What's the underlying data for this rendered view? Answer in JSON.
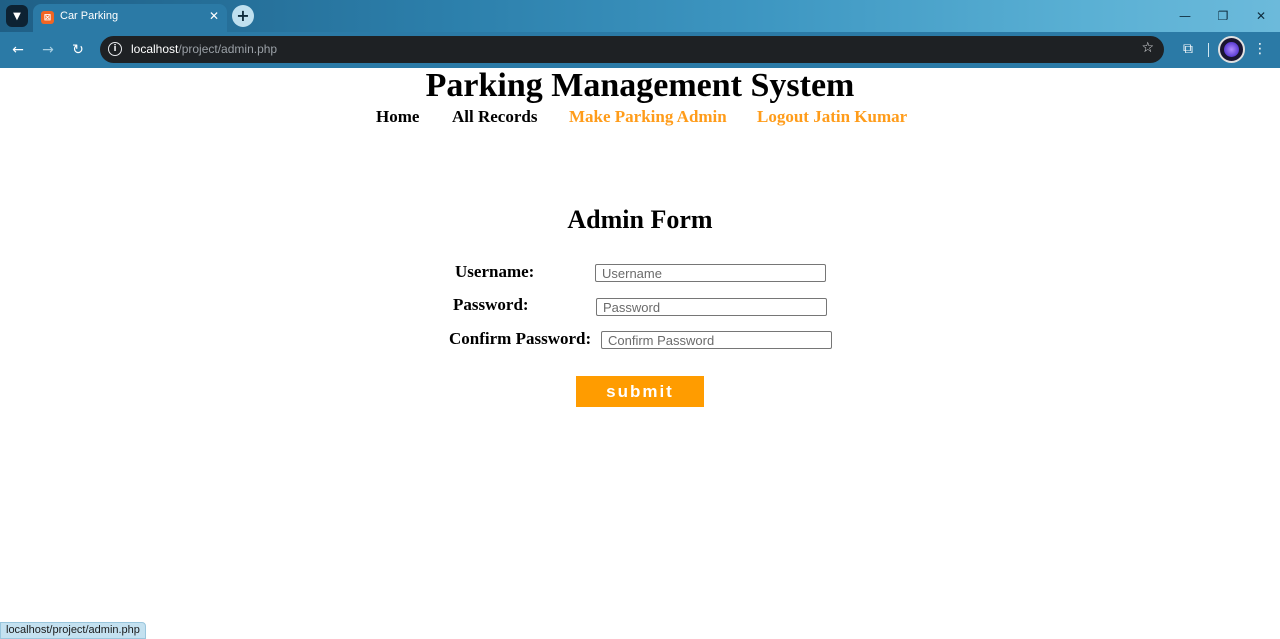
{
  "browser": {
    "tab_title": "Car Parking",
    "tab_favicon": "xampp-icon",
    "url_host": "localhost",
    "url_path": "/project/admin.php",
    "status_url": "localhost/project/admin.php"
  },
  "page": {
    "title": "Parking Management System",
    "nav": {
      "home": "Home",
      "all_records": "All Records",
      "make_admin": "Make Parking Admin",
      "logout": "Logout Jatin Kumar"
    },
    "form": {
      "title": "Admin Form",
      "username_label": "Username:",
      "username_placeholder": "Username",
      "password_label": "Password:",
      "password_placeholder": "Password",
      "confirm_label": "Confirm Password:",
      "confirm_placeholder": "Confirm Password",
      "submit_label": "submit"
    }
  },
  "colors": {
    "accent_orange": "#ff9c00",
    "nav_highlight": "#ff9c1a"
  }
}
